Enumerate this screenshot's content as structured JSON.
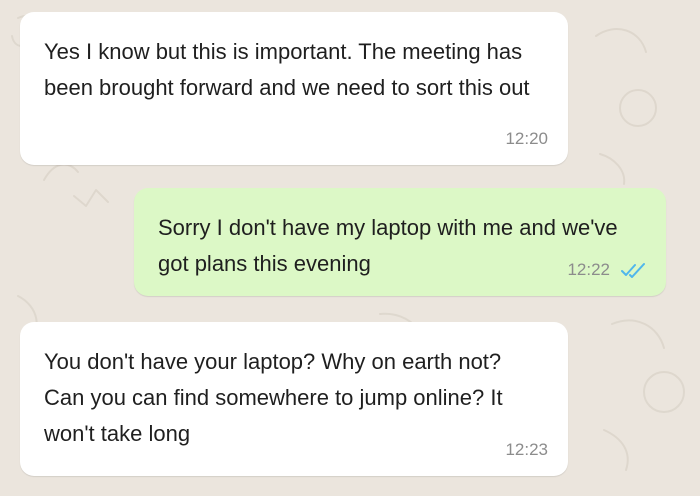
{
  "chat": {
    "messages": [
      {
        "direction": "incoming",
        "text": "Yes I know but this is important. The meeting has been brought forward and we need to sort this out",
        "time": "12:20"
      },
      {
        "direction": "outgoing",
        "text": "Sorry I don't have my laptop with me and we've got plans this evening",
        "time": "12:22",
        "status": "read",
        "status_icon": "double-check-icon"
      },
      {
        "direction": "incoming",
        "text": "You don't have your laptop? Why on earth not? Can you can find somewhere to jump online? It won't take long",
        "time": "12:23"
      }
    ]
  },
  "colors": {
    "background": "#ebe5dd",
    "incoming_bubble": "#ffffff",
    "outgoing_bubble": "#dcf8c6",
    "read_ticks": "#4fb6ec",
    "meta_text": "#8c8c8c"
  }
}
